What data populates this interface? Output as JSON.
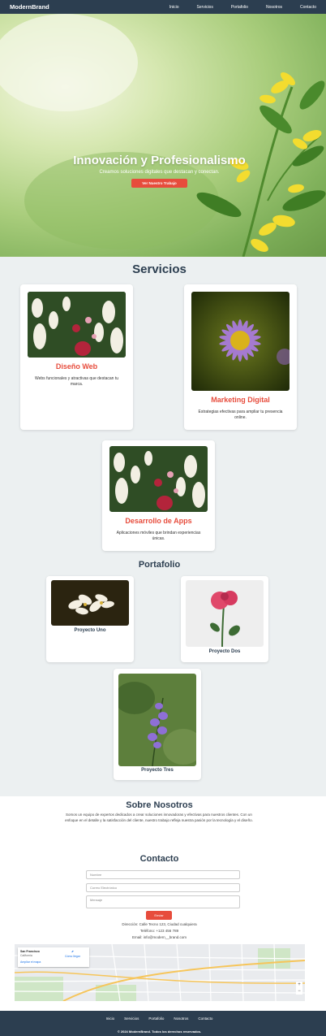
{
  "nav": {
    "brand": "ModernBrand",
    "links": [
      "Inicio",
      "Servicios",
      "Portafolio",
      "Nosotros",
      "Contacto"
    ]
  },
  "hero": {
    "title": "Innovación y Profesionalismo",
    "subtitle": "Creamos soluciones digitales que destacan y conectan.",
    "cta": "Ver Nuestro Trabajo"
  },
  "services": {
    "title": "Servicios",
    "items": [
      {
        "title": "Diseño Web",
        "desc": "Webs funcionales y atractivas que destacan tu marca."
      },
      {
        "title": "Marketing Digital",
        "desc": "Estrategias efectivas para ampliar tu presencia online."
      },
      {
        "title": "Desarrollo de Apps",
        "desc": "Aplicaciones móviles que brindan experiencias únicas."
      }
    ]
  },
  "portfolio": {
    "title": "Portafolio",
    "items": [
      {
        "title": "Proyecto Uno"
      },
      {
        "title": "Proyecto Dos"
      },
      {
        "title": "Proyecto Tres"
      }
    ]
  },
  "about": {
    "title": "Sobre Nosotros",
    "text": "Somos un equipo de expertos dedicados a crear soluciones innovadoras y efectivas para nuestros clientes. Con un enfoque en el detalle y la satisfacción del cliente, nuestro trabajo refleja nuestra pasión por la tecnología y el diseño."
  },
  "contact": {
    "title": "Contacto",
    "name_placeholder": "Nombre",
    "email_placeholder": "Correo Electrónico",
    "message_placeholder": "Mensaje",
    "send": "Enviar",
    "address": "Dirección: Calle Tecno 123, Ciudad cualquiera",
    "phone": "Teléfono: +123 456 789",
    "email": "Email: info@modern__brand.com"
  },
  "map": {
    "place": "San Francisco",
    "region": "California",
    "directions": "Cómo llegar",
    "enlarge": "Ampliar el mapa"
  },
  "footer": {
    "links": [
      "Inicio",
      "Servicios",
      "Portafolio",
      "Nosotros",
      "Contacto"
    ],
    "copyright": "© 2024 ModernBrand. Todos los derechos reservados."
  },
  "colors": {
    "navy": "#2c3e50",
    "accent": "#e74c3c",
    "section_bg": "#ecf0f1"
  }
}
